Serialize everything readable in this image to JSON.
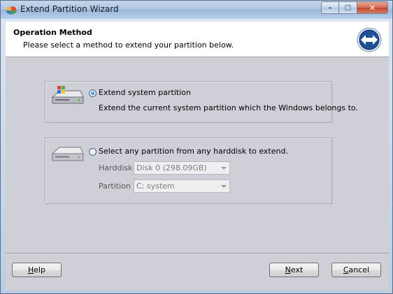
{
  "window": {
    "title": "Extend Partition Wizard",
    "caption": {
      "minimize": "–",
      "maximize": "□",
      "close": "✕"
    }
  },
  "header": {
    "title": "Operation Method",
    "subtitle": "Please select a method to extend your partition below."
  },
  "options": {
    "system": {
      "label": "Extend system partition",
      "description": "Extend the current system partition which the Windows belongs to.",
      "selected": true
    },
    "any": {
      "label": "Select any partition from any harddisk to extend.",
      "selected": false,
      "harddisk_label": "Harddisk",
      "harddisk_value": "Disk 0 (298.09GB)",
      "partition_label": "Partition",
      "partition_value": "C: system"
    }
  },
  "buttons": {
    "help": {
      "mnemonic": "H",
      "rest": "elp"
    },
    "next": {
      "mnemonic": "N",
      "rest": "ext"
    },
    "cancel": {
      "mnemonic": "C",
      "rest": "ancel"
    }
  }
}
